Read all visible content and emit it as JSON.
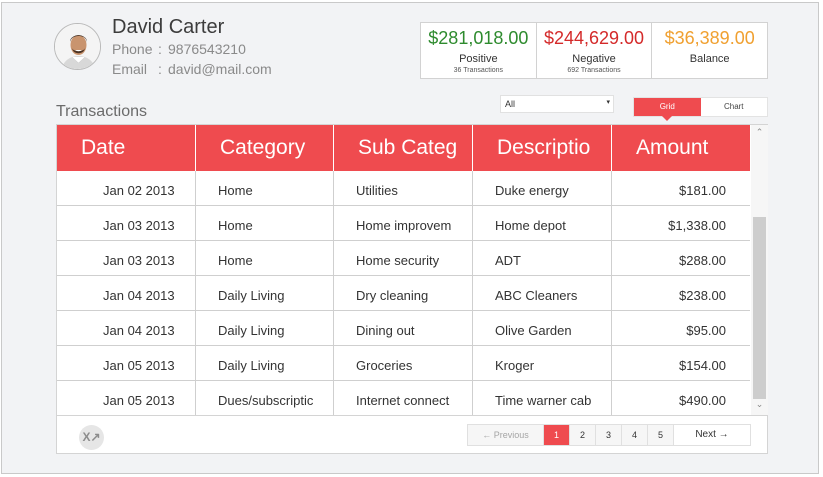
{
  "profile": {
    "name": "David Carter",
    "phone_label": "Phone",
    "phone_value": "9876543210",
    "email_label": "Email",
    "email_value": "david@mail.com",
    "separator": ":"
  },
  "summary": {
    "positive": {
      "amount": "$281,018.00",
      "label": "Positive",
      "sub": "36 Transactions",
      "color": "#2e8b2e"
    },
    "negative": {
      "amount": "$244,629.00",
      "label": "Negative",
      "sub": "692 Transactions",
      "color": "#d42a2a"
    },
    "balance": {
      "amount": "$36,389.00",
      "label": "Balance",
      "color": "#f0a030"
    }
  },
  "section": {
    "title": "Transactions",
    "filter_value": "All",
    "view_options": [
      "Grid",
      "Chart"
    ],
    "active_view": "Grid"
  },
  "grid": {
    "columns": [
      "Date",
      "Category",
      "Sub Categ",
      "Descriptio",
      "Amount"
    ],
    "rows": [
      [
        "Jan 02 2013",
        "Home",
        "Utilities",
        "Duke energy",
        "$181.00"
      ],
      [
        "Jan 03 2013",
        "Home",
        "Home improvem",
        "Home depot",
        "$1,338.00"
      ],
      [
        "Jan 03 2013",
        "Home",
        "Home security",
        "ADT",
        "$288.00"
      ],
      [
        "Jan 04 2013",
        "Daily Living",
        "Dry cleaning",
        "ABC Cleaners",
        "$238.00"
      ],
      [
        "Jan 04 2013",
        "Daily Living",
        "Dining out",
        "Olive Garden",
        "$95.00"
      ],
      [
        "Jan 05 2013",
        "Daily Living",
        "Groceries",
        "Kroger",
        "$154.00"
      ],
      [
        "Jan 05 2013",
        "Dues/subscriptic",
        "Internet connect",
        "Time warner cab",
        "$490.00"
      ]
    ]
  },
  "pager": {
    "prev_label": "Previous",
    "next_label": "Next",
    "pages": [
      "1",
      "2",
      "3",
      "4",
      "5"
    ],
    "active_page": "1"
  },
  "colors": {
    "accent": "#ef4b4f"
  },
  "icons": {
    "prev": "arrow-left-icon",
    "next": "arrow-right-icon",
    "export": "excel-export-icon",
    "filter_caret": "caret-down-icon"
  }
}
